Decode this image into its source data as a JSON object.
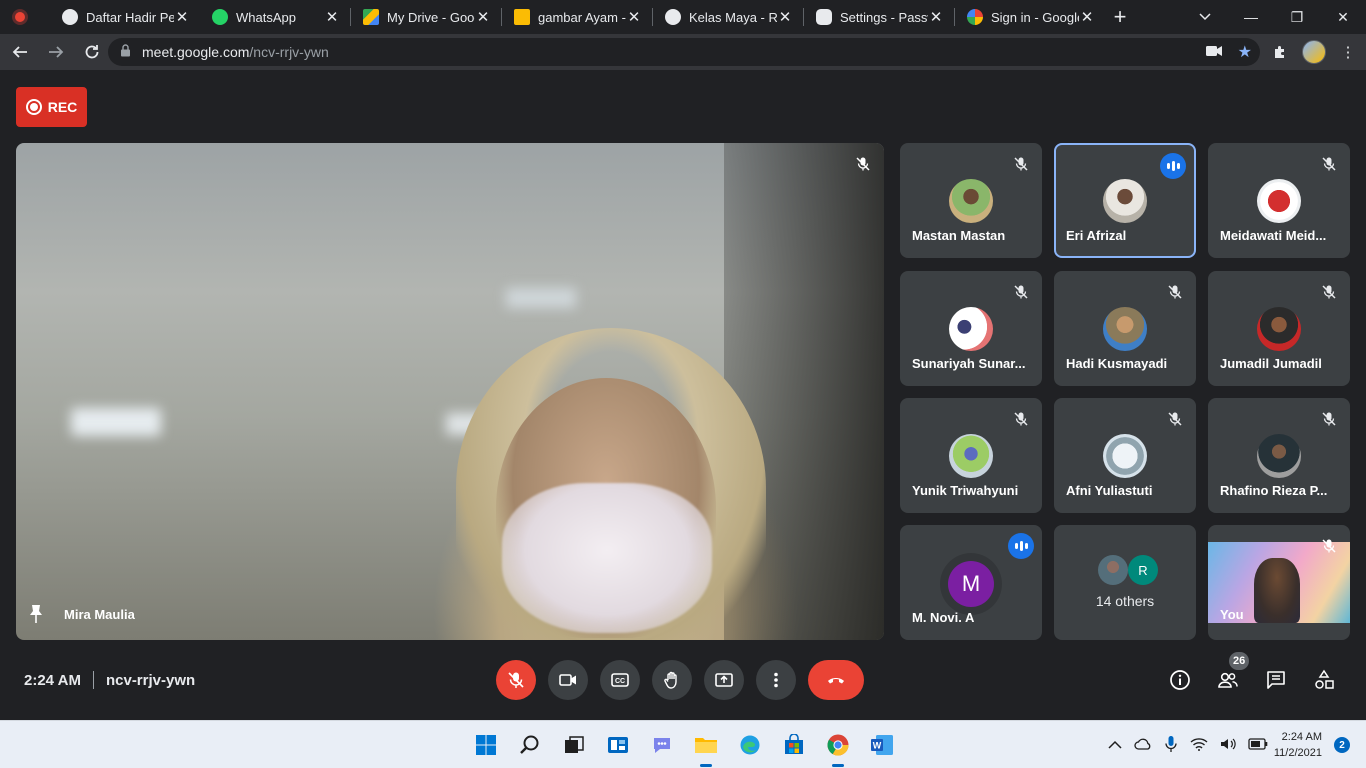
{
  "browser": {
    "tabs": [
      {
        "title": "",
        "favicon_color": "#ea4335"
      },
      {
        "title": "Daftar Hadir Per",
        "favicon_color": "#e8eaed"
      },
      {
        "title": "WhatsApp",
        "favicon_color": "#25d366"
      },
      {
        "title": "My Drive - Goog",
        "favicon_color": "#fbbc04"
      },
      {
        "title": "gambar Ayam -",
        "favicon_color": "#fbbc04"
      },
      {
        "title": "Kelas Maya - Ru",
        "favicon_color": "#e8eaed"
      },
      {
        "title": "Settings - Passw",
        "favicon_color": "#e8eaed"
      },
      {
        "title": "Sign in - Google",
        "favicon_color": "#4285f4"
      }
    ],
    "new_tab_label": "+",
    "url_host": "meet.google.com",
    "url_path": "/ncv-rrjv-ywn"
  },
  "meet": {
    "rec_label": "REC",
    "main_speaker": "Mira Maulia",
    "participants": [
      {
        "name": "Mastan Mastan",
        "speaking": false
      },
      {
        "name": "Eri Afrizal",
        "speaking": true
      },
      {
        "name": "Meidawati Meid...",
        "speaking": false
      },
      {
        "name": "Sunariyah Sunar...",
        "speaking": false
      },
      {
        "name": "Hadi Kusmayadi",
        "speaking": false
      },
      {
        "name": "Jumadil Jumadil",
        "speaking": false
      },
      {
        "name": "Yunik Triwahyuni",
        "speaking": false
      },
      {
        "name": "Afni Yuliastuti",
        "speaking": false
      },
      {
        "name": "Rhafino Rieza P...",
        "speaking": false
      },
      {
        "name": "M. Novi. A",
        "speaking": true,
        "initial": "M"
      }
    ],
    "others": {
      "label": "14 others",
      "initial": "R"
    },
    "self_label": "You",
    "time": "2:24 AM",
    "meeting_code": "ncv-rrjv-ywn",
    "participant_count": "26"
  },
  "taskbar": {
    "time": "2:24 AM",
    "date": "11/2/2021",
    "notifications": "2"
  },
  "colors": {
    "accent_blue": "#1a73e8",
    "danger_red": "#ea4335",
    "tile_bg": "#3c4043",
    "page_bg": "#202124"
  }
}
